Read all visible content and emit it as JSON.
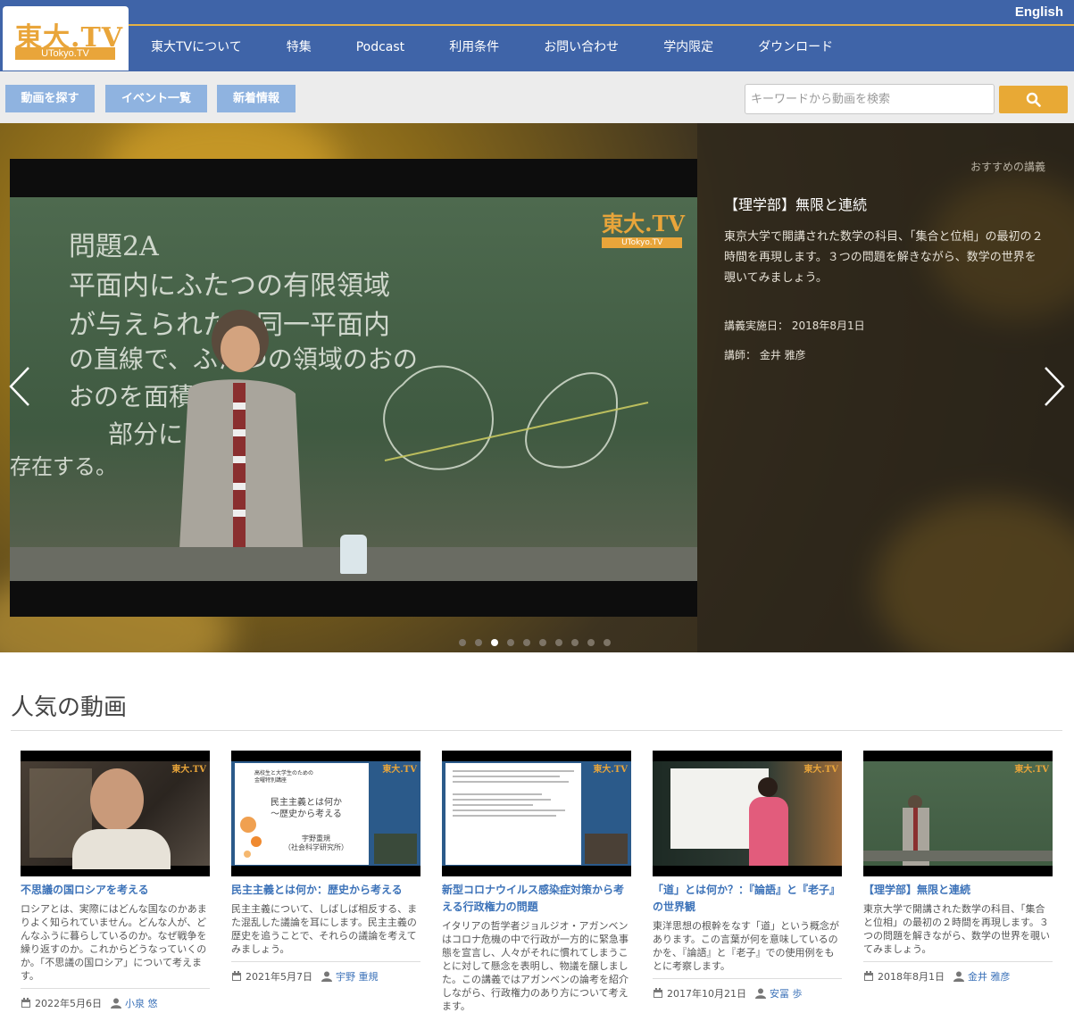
{
  "header": {
    "logo_kanji": "東大.TV",
    "logo_sub": "UTokyo.TV",
    "lang_link": "English",
    "nav": [
      {
        "label": "東大TVについて"
      },
      {
        "label": "特集"
      },
      {
        "label": "Podcast"
      },
      {
        "label": "利用条件"
      },
      {
        "label": "お問い合わせ"
      },
      {
        "label": "学内限定"
      },
      {
        "label": "ダウンロード"
      }
    ]
  },
  "subnav": {
    "buttons": [
      {
        "label": "動画を探す"
      },
      {
        "label": "イベント一覧"
      },
      {
        "label": "新着情報"
      }
    ],
    "search_placeholder": "キーワードから動画を検索",
    "search_icon": "search-icon"
  },
  "hero": {
    "label": "おすすめの講義",
    "title": "【理学部】無限と連続",
    "description": "東京大学で開講された数学の科目、「集合と位相」の最初の２時間を再現します。３つの問題を解きながら、数学の世界を覗いてみましょう。",
    "date_label": "講義実施日：",
    "date": "2018年8月1日",
    "lecturer_label": "講師：",
    "lecturer": "金井 雅彦",
    "watermark_kanji": "東大.TV",
    "watermark_sub": "UTokyo.TV",
    "chalk_lines": [
      "問題2A",
      "平面内にふたつの有限領域",
      "が与えられた。同一平面内",
      "の直線で、ふたつの領域のおの",
      "おのを面積",
      "部分に",
      "存在する。"
    ],
    "slide_count": 10,
    "active_slide": 3
  },
  "popular": {
    "title": "人気の動画",
    "items": [
      {
        "title": "不思議の国ロシアを考える",
        "description": "ロシアとは、実際にはどんな国なのかあまりよく知られていません。どんな人が、どんなふうに暮らしているのか。なぜ戦争を繰り返すのか。これからどうなっていくのか。「不思議の国ロシア」について考えます。",
        "date": "2022年5月6日",
        "author": "小泉 悠"
      },
      {
        "title": "民主主義とは何か：歴史から考える",
        "description": "民主主義について、しばしば相反する、また混乱した議論を耳にします。民主主義の歴史を追うことで、それらの議論を考えてみましょう。",
        "date": "2021年5月7日",
        "author": "宇野 重規",
        "slide_head": "高校生と大学生のための\n金曜特別講座",
        "slide_title": "民主主義とは何か\n〜歴史から考える",
        "slide_speaker": "宇野重規\n（社会科学研究所）"
      },
      {
        "title": "新型コロナウイルス感染症対策から考える行政権力の問題",
        "description": "イタリアの哲学者ジョルジオ・アガンベンはコロナ危機の中で行政が一方的に緊急事態を宣言し、人々がそれに慣れてしまうことに対して懸念を表明し、物議を醸しました。この講義ではアガンベンの論考を紹介しながら、行政権力のあり方について考えます。",
        "date": "",
        "author": ""
      },
      {
        "title": "「道」とは何か？：『論語』と『老子』の世界観",
        "description": "東洋思想の根幹をなす「道」という概念があります。この言葉が何を意味しているのかを、『論語』と『老子』での使用例をもとに考察します。",
        "date": "2017年10月21日",
        "author": "安冨 歩"
      },
      {
        "title": "【理学部】無限と連続",
        "description": "東京大学で開講された数学の科目、「集合と位相」の最初の２時間を再現します。３つの問題を解きながら、数学の世界を覗いてみましょう。",
        "date": "2018年8月1日",
        "author": "金井 雅彦"
      }
    ],
    "thumb_watermark": "東大.TV"
  },
  "colors": {
    "header_blue": "#3f64a8",
    "accent_orange": "#e8a935",
    "link_blue": "#3d73b9",
    "subnav_button": "#8fb3e0"
  }
}
